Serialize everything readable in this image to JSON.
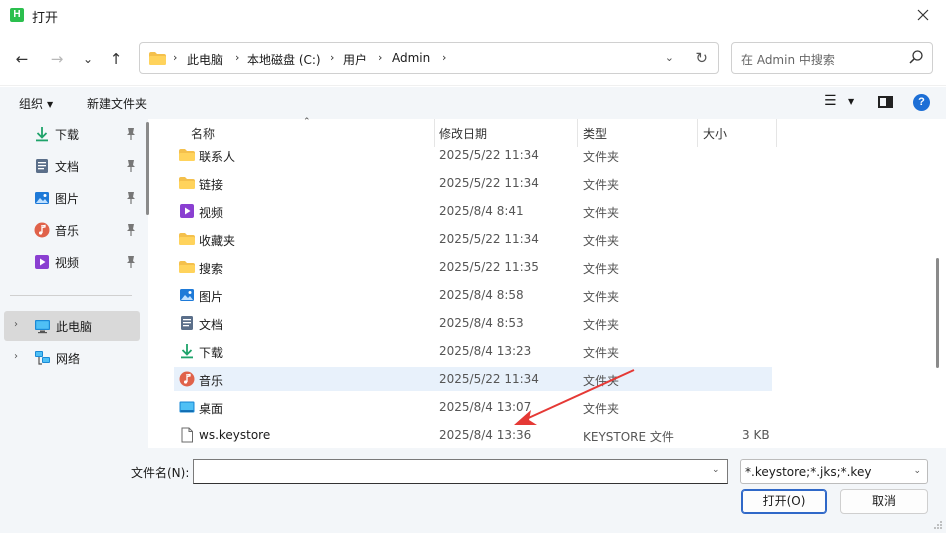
{
  "window": {
    "title": "打开",
    "app_icon_letter": "H"
  },
  "nav": {
    "back": "←",
    "forward": "→",
    "recent": "⌄",
    "up": "↑",
    "breadcrumbs": [
      "此电脑",
      "本地磁盘 (C:)",
      "用户",
      "Admin"
    ],
    "search_placeholder": "在 Admin 中搜索"
  },
  "toolbar": {
    "organize": "组织",
    "new_folder": "新建文件夹"
  },
  "sidebar": {
    "quick_access": [
      {
        "label": "下载",
        "icon": "download-icon",
        "color": "#1ea36a"
      },
      {
        "label": "文档",
        "icon": "document-icon",
        "color": "#5b6f8a"
      },
      {
        "label": "图片",
        "icon": "picture-icon",
        "color": "#1e7ad8"
      },
      {
        "label": "音乐",
        "icon": "music-icon",
        "color": "#e0624a"
      },
      {
        "label": "视频",
        "icon": "video-icon",
        "color": "#8a3fd1"
      }
    ],
    "tree": [
      {
        "label": "此电脑",
        "icon": "computer-icon",
        "selected": true
      },
      {
        "label": "网络",
        "icon": "network-icon",
        "selected": false
      }
    ]
  },
  "file_list": {
    "columns": [
      "名称",
      "修改日期",
      "类型",
      "大小"
    ],
    "rows": [
      {
        "name": "联系人",
        "date": "2025/5/22 11:34",
        "type": "文件夹",
        "size": "",
        "icon": "folder-icon"
      },
      {
        "name": "链接",
        "date": "2025/5/22 11:34",
        "type": "文件夹",
        "size": "",
        "icon": "folder-icon"
      },
      {
        "name": "视频",
        "date": "2025/8/4 8:41",
        "type": "文件夹",
        "size": "",
        "icon": "video-folder-icon"
      },
      {
        "name": "收藏夹",
        "date": "2025/5/22 11:34",
        "type": "文件夹",
        "size": "",
        "icon": "folder-icon"
      },
      {
        "name": "搜索",
        "date": "2025/5/22 11:35",
        "type": "文件夹",
        "size": "",
        "icon": "folder-icon"
      },
      {
        "name": "图片",
        "date": "2025/8/4 8:58",
        "type": "文件夹",
        "size": "",
        "icon": "picture-folder-icon"
      },
      {
        "name": "文档",
        "date": "2025/8/4 8:53",
        "type": "文件夹",
        "size": "",
        "icon": "document-folder-icon"
      },
      {
        "name": "下载",
        "date": "2025/8/4 13:23",
        "type": "文件夹",
        "size": "",
        "icon": "download-folder-icon"
      },
      {
        "name": "音乐",
        "date": "2025/5/22 11:34",
        "type": "文件夹",
        "size": "",
        "icon": "music-folder-icon"
      },
      {
        "name": "桌面",
        "date": "2025/8/4 13:07",
        "type": "文件夹",
        "size": "",
        "icon": "desktop-folder-icon"
      },
      {
        "name": "ws.keystore",
        "date": "2025/8/4 13:36",
        "type": "KEYSTORE 文件",
        "size": "3 KB",
        "icon": "file-icon"
      }
    ],
    "hovered_row": 8
  },
  "bottom": {
    "filename_label": "文件名(N):",
    "filename_value": "",
    "filter_value": "*.keystore;*.jks;*.key",
    "open_label": "打开(O)",
    "cancel_label": "取消"
  },
  "colors": {
    "folder": "#f4c04c",
    "annotation_arrow": "#e53935",
    "accent": "#1d6fd6"
  }
}
